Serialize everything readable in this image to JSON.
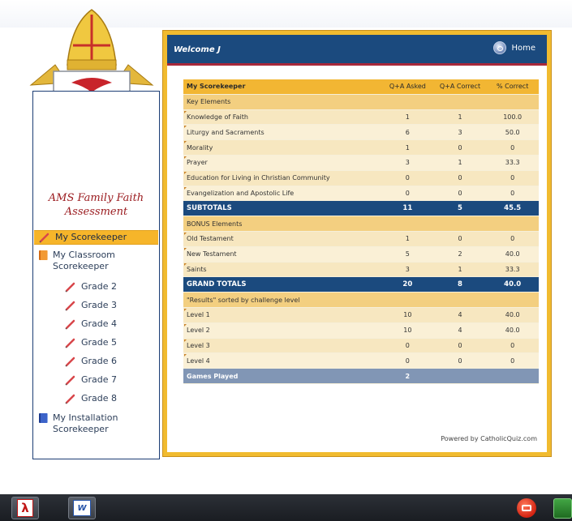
{
  "sidebar": {
    "title": "AMS Family Faith Assessment",
    "items": [
      {
        "label": "My Scorekeeper",
        "icon": "pencil-icon",
        "active": true
      },
      {
        "label": "My Classroom Scorekeeper",
        "icon": "book-icon"
      },
      {
        "label": "Grade 2",
        "icon": "pencil-icon"
      },
      {
        "label": "Grade 3",
        "icon": "pencil-icon"
      },
      {
        "label": "Grade 4",
        "icon": "pencil-icon"
      },
      {
        "label": "Grade 5",
        "icon": "pencil-icon"
      },
      {
        "label": "Grade 6",
        "icon": "pencil-icon"
      },
      {
        "label": "Grade 7",
        "icon": "pencil-icon"
      },
      {
        "label": "Grade 8",
        "icon": "pencil-icon"
      },
      {
        "label": "My Installation Scorekeeper",
        "icon": "book-icon"
      }
    ]
  },
  "header": {
    "welcome": "Welcome J",
    "home_label": "Home"
  },
  "table": {
    "title": "My Scorekeeper",
    "columns": [
      "Q+A Asked",
      "Q+A Correct",
      "% Correct"
    ],
    "key_section": "Key Elements",
    "key_rows": [
      {
        "label": "Knowledge of Faith",
        "asked": "1",
        "correct": "1",
        "pct": "100.0"
      },
      {
        "label": "Liturgy and Sacraments",
        "asked": "6",
        "correct": "3",
        "pct": "50.0"
      },
      {
        "label": "Morality",
        "asked": "1",
        "correct": "0",
        "pct": "0"
      },
      {
        "label": "Prayer",
        "asked": "3",
        "correct": "1",
        "pct": "33.3"
      },
      {
        "label": "Education for Living in Christian Community",
        "asked": "0",
        "correct": "0",
        "pct": "0"
      },
      {
        "label": "Evangelization and Apostolic Life",
        "asked": "0",
        "correct": "0",
        "pct": "0"
      }
    ],
    "subtotals": {
      "label": "SUBTOTALS",
      "asked": "11",
      "correct": "5",
      "pct": "45.5"
    },
    "bonus_section": "BONUS Elements",
    "bonus_rows": [
      {
        "label": "Old Testament",
        "asked": "1",
        "correct": "0",
        "pct": "0"
      },
      {
        "label": "New Testament",
        "asked": "5",
        "correct": "2",
        "pct": "40.0"
      },
      {
        "label": "Saints",
        "asked": "3",
        "correct": "1",
        "pct": "33.3"
      }
    ],
    "grand_totals": {
      "label": "GRAND TOTALS",
      "asked": "20",
      "correct": "8",
      "pct": "40.0"
    },
    "levels_section": "\"Results\" sorted by challenge level",
    "level_rows": [
      {
        "label": "Level 1",
        "asked": "10",
        "correct": "4",
        "pct": "40.0"
      },
      {
        "label": "Level 2",
        "asked": "10",
        "correct": "4",
        "pct": "40.0"
      },
      {
        "label": "Level 3",
        "asked": "0",
        "correct": "0",
        "pct": "0"
      },
      {
        "label": "Level 4",
        "asked": "0",
        "correct": "0",
        "pct": "0"
      }
    ],
    "games": {
      "label": "Games Played",
      "value": "2"
    }
  },
  "footer": {
    "powered": "Powered by CatholicQuiz.com"
  },
  "taskbar": {
    "items": [
      "pdf-reader-icon",
      "word-icon",
      "tray-app-icon",
      "tray-network-icon"
    ]
  },
  "colors": {
    "navy": "#1b4a7e",
    "gold": "#f1bb2f",
    "crimson": "#9b1c20"
  }
}
